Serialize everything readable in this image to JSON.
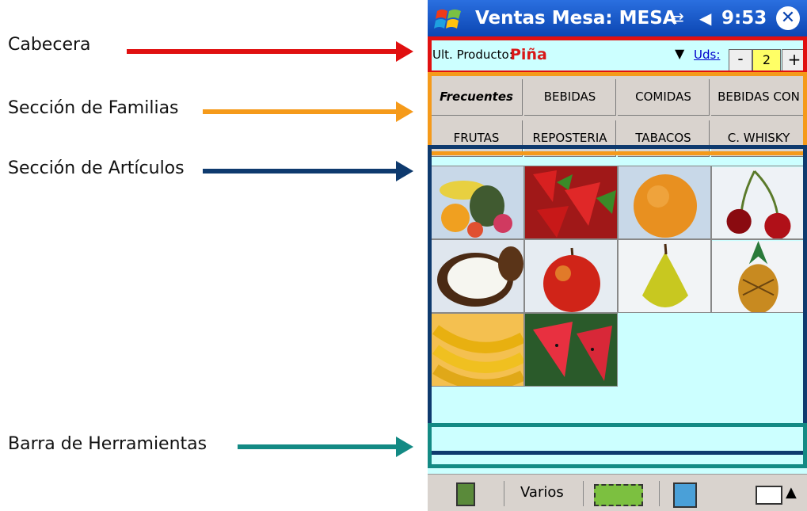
{
  "annotations": [
    {
      "label": "Cabecera",
      "color": "#e01010"
    },
    {
      "label": "Sección de Familias",
      "color": "#f59a1a"
    },
    {
      "label": "Sección de Artículos",
      "color": "#0e3a6e"
    },
    {
      "label": "Barra de Herramientas",
      "color": "#138a84"
    }
  ],
  "device": {
    "title": "Ventas Mesa: MESA",
    "clock": "9:53",
    "header": {
      "last_product_label": "Ult. Producto:",
      "last_product_value": "Piña",
      "units_label": "Uds:",
      "minus_label": "-",
      "quantity": "2",
      "plus_label": "+"
    },
    "families": [
      "Frecuentes",
      "BEBIDAS",
      "COMIDAS",
      "BEBIDAS CON",
      "FRUTAS",
      "REPOSTERIA",
      "TABACOS",
      "C. WHISKY"
    ],
    "articles": [
      {
        "icon": "fruit-assortment-image"
      },
      {
        "icon": "strawberries-image"
      },
      {
        "icon": "orange-image"
      },
      {
        "icon": "cherries-image"
      },
      {
        "icon": "coconut-image"
      },
      {
        "icon": "apple-image"
      },
      {
        "icon": "pear-image"
      },
      {
        "icon": "pineapple-image"
      },
      {
        "icon": "bananas-image"
      },
      {
        "icon": "watermelon-image"
      }
    ],
    "toolbar": {
      "varios_label": "Varios"
    }
  }
}
